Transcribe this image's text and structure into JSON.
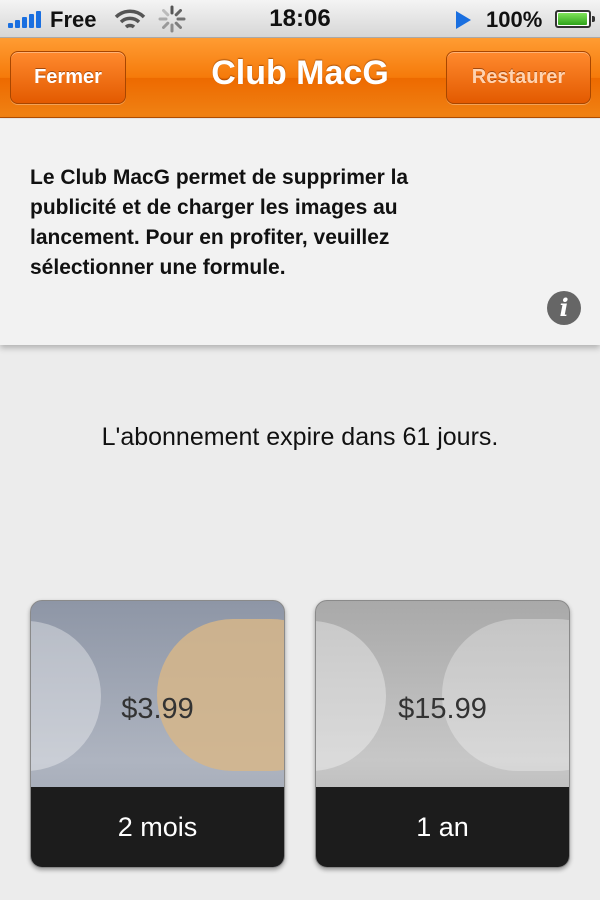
{
  "status_bar": {
    "carrier": "Free",
    "time": "18:06",
    "battery": "100%",
    "signal_icon": "signal-bars-icon",
    "wifi_icon": "wifi-icon",
    "activity_icon": "activity-spinner-icon",
    "play_icon": "play-icon",
    "battery_icon": "battery-icon"
  },
  "nav": {
    "title": "Club MacG",
    "left_button": "Fermer",
    "right_button": "Restaurer",
    "accent": "#f57a0a"
  },
  "info": {
    "text": "Le Club MacG permet de supprimer la publicité et de charger les images au lancement. Pour en profiter, veuillez sélectionner une formule.",
    "icon": "info-icon",
    "icon_glyph": "i"
  },
  "subscription": {
    "expire_text": "L'abonnement expire dans 61 jours."
  },
  "plans": [
    {
      "price": "$3.99",
      "duration": "2 mois"
    },
    {
      "price": "$15.99",
      "duration": "1 an"
    }
  ]
}
